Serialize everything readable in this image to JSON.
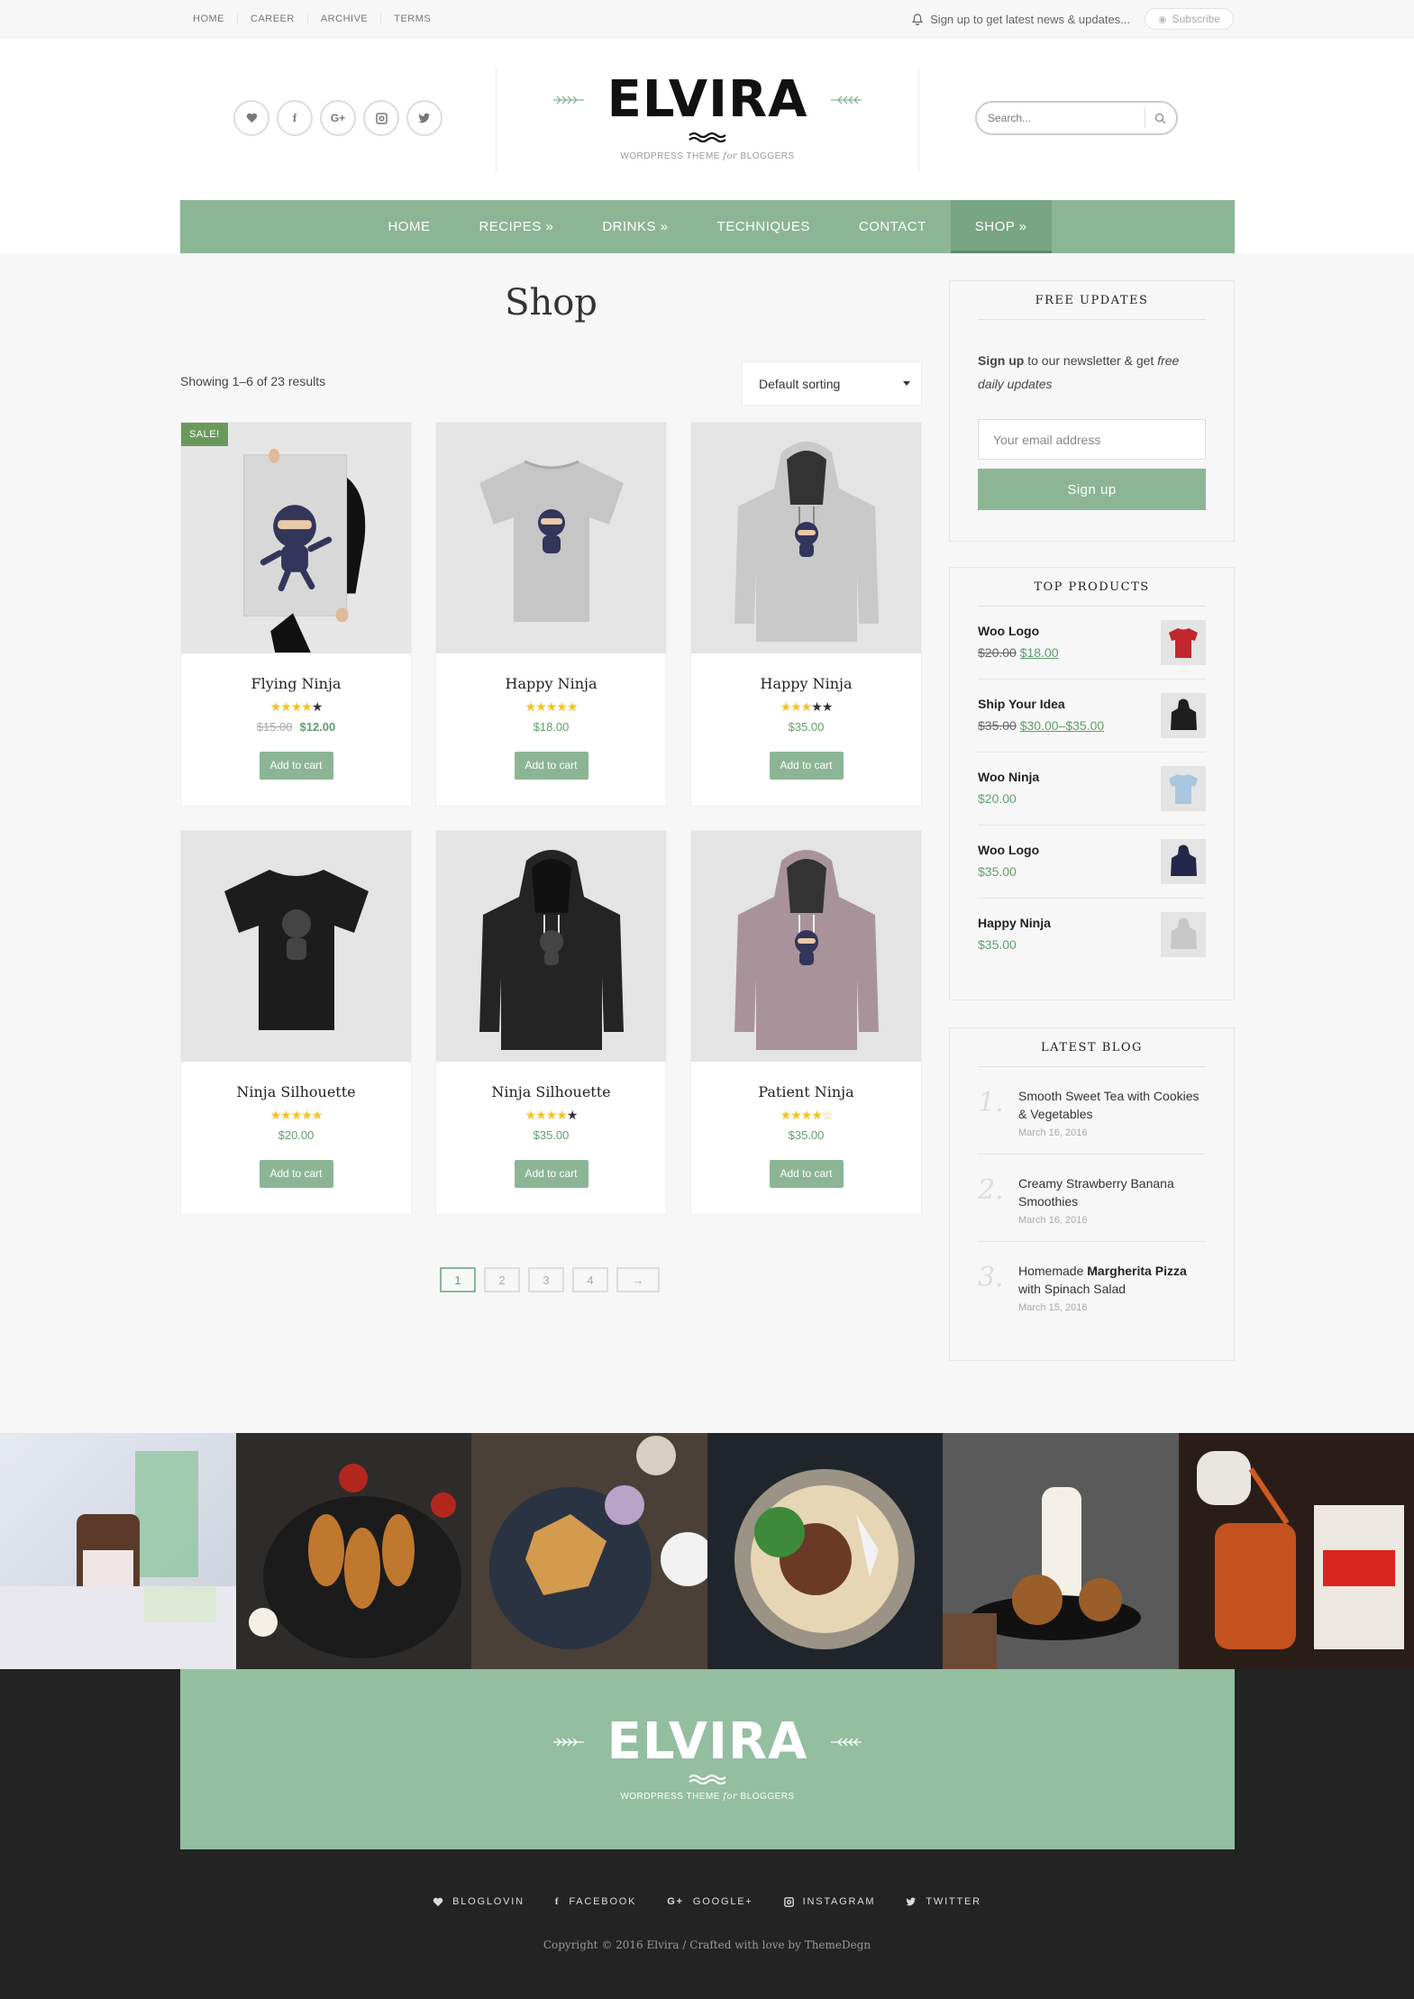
{
  "topbar": {
    "nav": [
      "HOME",
      "CAREER",
      "ARCHIVE",
      "TERMS"
    ],
    "signup_text": "Sign up to get latest news & updates...",
    "subscribe_label": "Subscribe"
  },
  "header": {
    "logo": "ELVIRA",
    "tagline_pre": "WORDPRESS THEME ",
    "tagline_em": "for",
    "tagline_post": " BLOGGERS",
    "search_placeholder": "Search..."
  },
  "mainnav": {
    "items": [
      "HOME",
      "RECIPES »",
      "DRINKS »",
      "TECHNIQUES",
      "CONTACT",
      "SHOP »"
    ],
    "active": "SHOP »"
  },
  "shop": {
    "title": "Shop",
    "result_count": "Showing 1–6 of 23 results",
    "sort_label": "Default sorting",
    "sale_badge": "SALE!",
    "add_to_cart": "Add to cart",
    "products": [
      {
        "name": "Flying Ninja",
        "rating": 4,
        "old_price": "$15.00",
        "price": "$12.00",
        "sale": true
      },
      {
        "name": "Happy Ninja",
        "rating": 5,
        "price": "$18.00"
      },
      {
        "name": "Happy Ninja",
        "rating": 3,
        "price": "$35.00"
      },
      {
        "name": "Ninja Silhouette",
        "rating": 5,
        "price": "$20.00"
      },
      {
        "name": "Ninja Silhouette",
        "rating": 4,
        "price": "$35.00"
      },
      {
        "name": "Patient Ninja",
        "rating": 4.5,
        "price": "$35.00"
      }
    ],
    "pagination": [
      "1",
      "2",
      "3",
      "4",
      "→"
    ],
    "current_page": "1"
  },
  "sidebar": {
    "free_updates": {
      "title": "FREE UPDATES",
      "text_bold": "Sign up",
      "text_mid": " to our newsletter & get ",
      "text_em": "free daily updates",
      "email_placeholder": "Your email address",
      "button": "Sign up"
    },
    "top_products": {
      "title": "TOP PRODUCTS",
      "items": [
        {
          "name": "Woo Logo",
          "old_price": "$20.00",
          "price": "$18.00",
          "thumb_color": "#c0282d"
        },
        {
          "name": "Ship Your Idea",
          "old_price": "$35.00",
          "price": "$30.00–$35.00",
          "thumb_color": "#1e1e1e"
        },
        {
          "name": "Woo Ninja",
          "price": "$20.00",
          "thumb_color": "#a9c7e0"
        },
        {
          "name": "Woo Logo",
          "price": "$35.00",
          "thumb_color": "#22264a"
        },
        {
          "name": "Happy Ninja",
          "price": "$35.00",
          "thumb_color": "#c8c8c8"
        }
      ]
    },
    "latest_blog": {
      "title": "LATEST BLOG",
      "items": [
        {
          "num": "1.",
          "title": "Smooth Sweet Tea with Cookies & Vegetables",
          "date": "March 16, 2016"
        },
        {
          "num": "2.",
          "title": "Creamy Strawberry Banana Smoothies",
          "date": "March 16, 2016"
        },
        {
          "num": "3.",
          "title_pre": "Homemade ",
          "title_bold": "Margherita Pizza",
          "title_post": " with Spinach Salad",
          "date": "March 15, 2016"
        }
      ]
    }
  },
  "footer": {
    "logo": "ELVIRA",
    "tagline_pre": "WORDPRESS THEME ",
    "tagline_em": "for",
    "tagline_post": " BLOGGERS",
    "social": [
      "BLOGLOVIN",
      "FACEBOOK",
      "GOOGLE+",
      "INSTAGRAM",
      "TWITTER"
    ],
    "copyright": "Copyright © 2016 Elvira / Crafted with love by ThemeDegn"
  },
  "colors": {
    "accent": "#8cb596",
    "price_green": "#5f9e6c",
    "sale_badge": "#6a9a5b",
    "footer_dark": "#232323",
    "star": "#f5c12a"
  },
  "icons": {
    "header_social": [
      "heart-icon",
      "facebook-icon",
      "google-plus-icon",
      "instagram-icon",
      "twitter-icon"
    ],
    "topbar_bell": "bell-icon",
    "subscribe": "rss-icon",
    "search": "search-icon"
  }
}
